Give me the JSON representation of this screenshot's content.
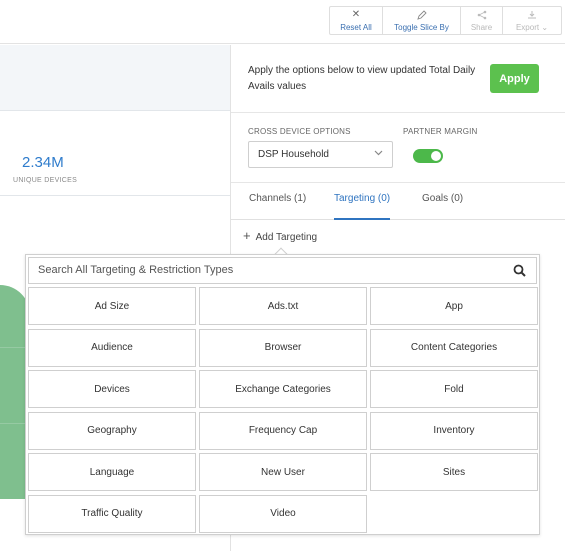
{
  "toolbar": {
    "reset": {
      "label": "Reset All",
      "icon": "close-icon"
    },
    "toggle": {
      "label": "Toggle Slice By",
      "icon": "pencil-icon"
    },
    "share": {
      "label": "Share",
      "icon": "share-icon"
    },
    "export": {
      "label": "Export",
      "icon": "download-icon"
    }
  },
  "stat": {
    "value": "2.34M",
    "label": "UNIQUE DEVICES"
  },
  "panel": {
    "apply_message": "Apply the options below to view updated Total Daily Avails values",
    "apply_label": "Apply",
    "cross_device": {
      "label": "CROSS DEVICE OPTIONS",
      "selected": "DSP Household"
    },
    "partner_margin": {
      "label": "PARTNER MARGIN",
      "enabled": true
    },
    "tabs": [
      {
        "label": "Channels (1)",
        "active": false
      },
      {
        "label": "Targeting (0)",
        "active": true
      },
      {
        "label": "Goals (0)",
        "active": false
      }
    ],
    "add_targeting": "Add Targeting"
  },
  "dropdown": {
    "search_placeholder": "Search All Targeting & Restriction Types",
    "items": [
      "Ad Size",
      "Ads.txt",
      "App",
      "Audience",
      "Browser",
      "Content Categories",
      "Devices",
      "Exchange Categories",
      "Fold",
      "Geography",
      "Frequency Cap",
      "Inventory",
      "Language",
      "New User",
      "Sites",
      "Traffic Quality",
      "Video"
    ]
  },
  "colors": {
    "accent": "#2f74c0",
    "apply": "#5cc14e",
    "toggle": "#4cb84a",
    "chart_fill": "#7fbf8e"
  }
}
